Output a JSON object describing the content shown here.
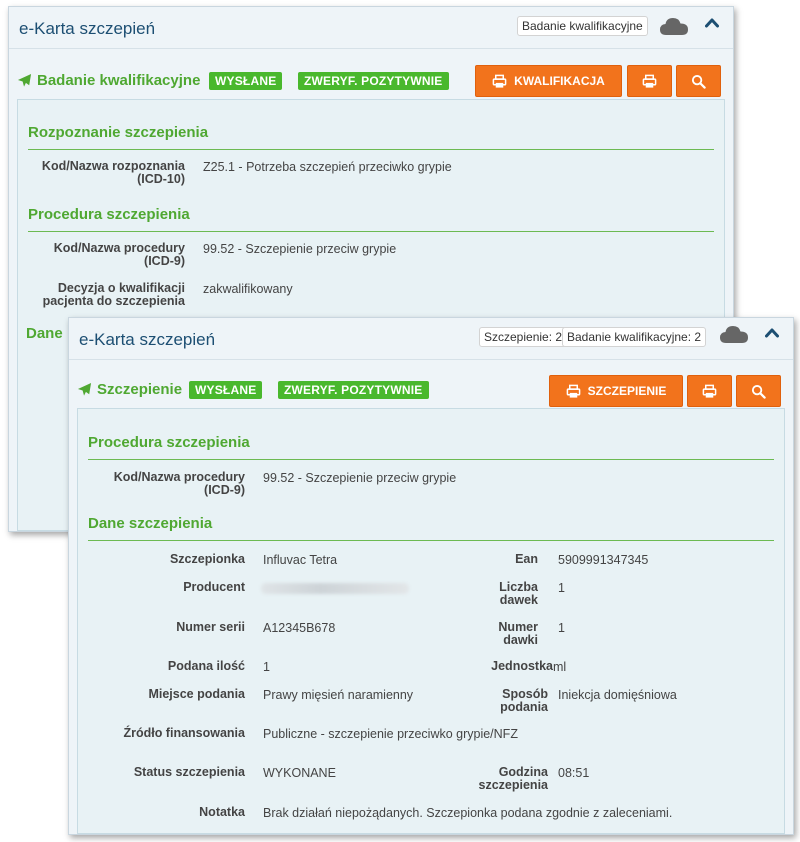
{
  "back": {
    "header": {
      "title": "e-Karta szczepień",
      "badge": "Badanie kwalifikacyjne"
    },
    "section": {
      "title": "Badanie kwalifikacyjne",
      "tags": [
        "WYSŁANE",
        "ZWERYF. POZYTYWNIE"
      ],
      "buttons": {
        "qualify_label": "KWALIFIKACJA"
      }
    },
    "diagnosis": {
      "heading": "Rozpoznanie szczepienia",
      "code_label": "Kod/Nazwa rozpoznania (ICD-10)",
      "code_value": "Z25.1 - Potrzeba szczepień przeciwko grypie"
    },
    "procedure": {
      "heading": "Procedura szczepienia",
      "code_label": "Kod/Nazwa procedury (ICD-9)",
      "code_value": "99.52 - Szczepienie przeciw grypie",
      "decision_label": "Decyzja o kwalifikacji pacjenta do szczepienia",
      "decision_value": "zakwalifikowany"
    },
    "next_heading": "Dane"
  },
  "front": {
    "header": {
      "title": "e-Karta szczepień",
      "badge1": "Szczepienie: 2",
      "badge2": "Badanie kwalifikacyjne: 2"
    },
    "section": {
      "title": "Szczepienie",
      "tags": [
        "WYSŁANE",
        "ZWERYF. POZYTYWNIE"
      ],
      "buttons": {
        "vaccinate_label": "SZCZEPIENIE"
      }
    },
    "procedure": {
      "heading": "Procedura szczepienia",
      "code_label": "Kod/Nazwa procedury (ICD-9)",
      "code_value": "99.52 - Szczepienie przeciw grypie"
    },
    "vaccination": {
      "heading": "Dane szczepienia",
      "fields": {
        "vaccine": {
          "label": "Szczepionka",
          "value": "Influvac Tetra"
        },
        "ean": {
          "label": "Ean",
          "value": "5909991347345"
        },
        "producer": {
          "label": "Producent",
          "value": ""
        },
        "dose_count": {
          "label": "Liczba dawek",
          "value": "1"
        },
        "serial": {
          "label": "Numer serii",
          "value": "A12345B678"
        },
        "dose_number": {
          "label": "Numer dawki",
          "value": "1"
        },
        "amount": {
          "label": "Podana ilość",
          "value": "1"
        },
        "unit": {
          "label": "Jednostka",
          "value": "ml"
        },
        "site": {
          "label": "Miejsce podania",
          "value": "Prawy mięsień naramienny"
        },
        "route": {
          "label": "Sposób podania",
          "value": "Iniekcja domięśniowa"
        },
        "funding": {
          "label": "Źródło finansowania",
          "value": "Publiczne - szczepienie przeciwko grypie/NFZ"
        },
        "status": {
          "label": "Status szczepienia",
          "value": "WYKONANE"
        },
        "time": {
          "label": "Godzina szczepienia",
          "value": "08:51"
        },
        "note": {
          "label": "Notatka",
          "value": "Brak działań niepożądanych. Szczepionka podana zgodnie z zaleceniami."
        }
      }
    }
  },
  "colors": {
    "accent_green": "#4fa832",
    "tag_green": "#49b82d",
    "button_orange": "#f2731c",
    "title_blue": "#1d4f73"
  },
  "icons": [
    "cloud-icon",
    "chevron-up-icon",
    "paper-plane-icon",
    "printer-icon",
    "search-icon"
  ]
}
